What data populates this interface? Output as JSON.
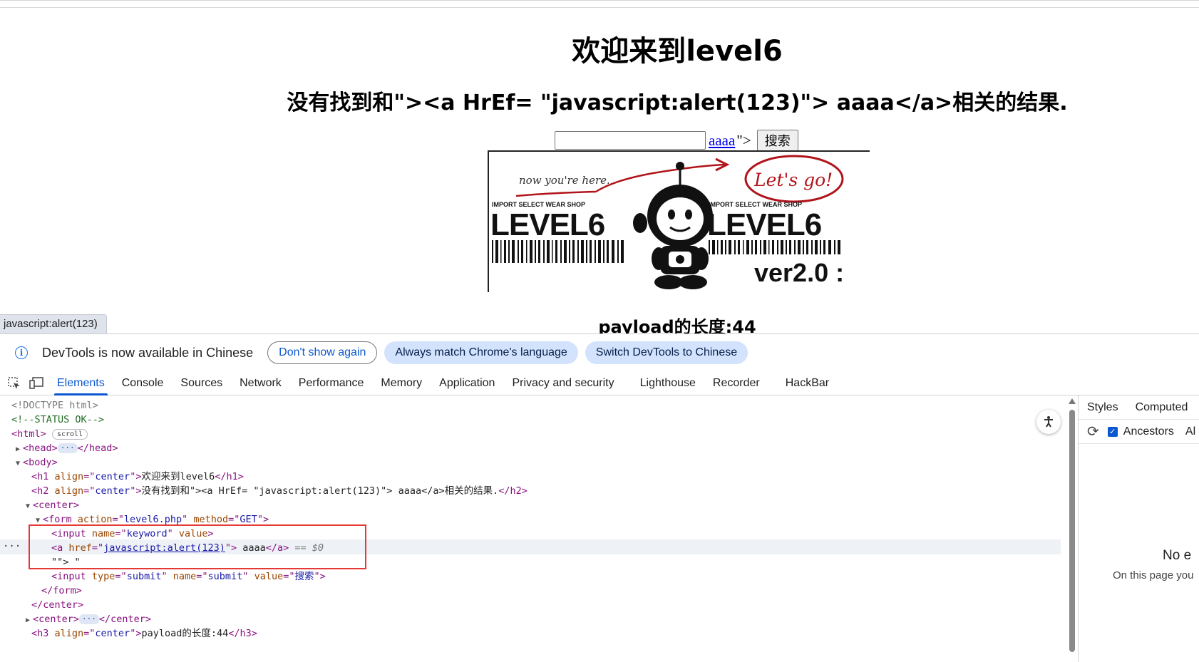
{
  "page": {
    "h1": "欢迎来到level6",
    "h2": "没有找到和\"><a HrEf= \"javascript:alert(123)\"> aaaa</a>相关的结果.",
    "injected_link_text": "aaaa",
    "injected_rest": "\">",
    "submit_label": "搜索",
    "banner": {
      "note": "now you're here.",
      "lets_go": "Let's go!",
      "brand_small": "IMPORT SELECT WEAR SHOP",
      "brand_big": "LEVEL6",
      "version": "ver2.0 :"
    },
    "status_url": "javascript:alert(123)",
    "h3": "payload的长度:44"
  },
  "devtools": {
    "infobar": {
      "text": "DevTools is now available in Chinese",
      "dont_show": "Don't show again",
      "always_match": "Always match Chrome's language",
      "switch": "Switch DevTools to Chinese"
    },
    "tabs": [
      "Elements",
      "Console",
      "Sources",
      "Network",
      "Performance",
      "Memory",
      "Application",
      "Privacy and security",
      "Lighthouse",
      "Recorder",
      "HackBar"
    ],
    "dom": {
      "doctype": "<!DOCTYPE html>",
      "comment": "<!--STATUS OK-->",
      "html_open": "<html>",
      "scroll_badge": "scroll",
      "head_open": "<head>",
      "head_close": "</head>",
      "body_open": "<body>",
      "h1_text": "欢迎来到level6",
      "h2_text": "没有找到和\"><a HrEf= \"javascript:alert(123)\"> aaaa</a>相关的结果.",
      "center_open": "<center>",
      "form_action": "level6.php",
      "form_method": "GET",
      "input_name": "keyword",
      "a_href": "javascript:alert(123)",
      "a_text": " aaaa",
      "eq_dollar": "== $0",
      "text_node": "\"\"> \"",
      "submit_type": "submit",
      "submit_name": "submit",
      "submit_value": "搜索",
      "h3_text": "payload的长度:44"
    },
    "styles": {
      "tab_styles": "Styles",
      "tab_computed": "Computed",
      "ancestors": "Ancestors",
      "al": "Al",
      "no_el": "No e",
      "on_page": "On this page you"
    }
  }
}
